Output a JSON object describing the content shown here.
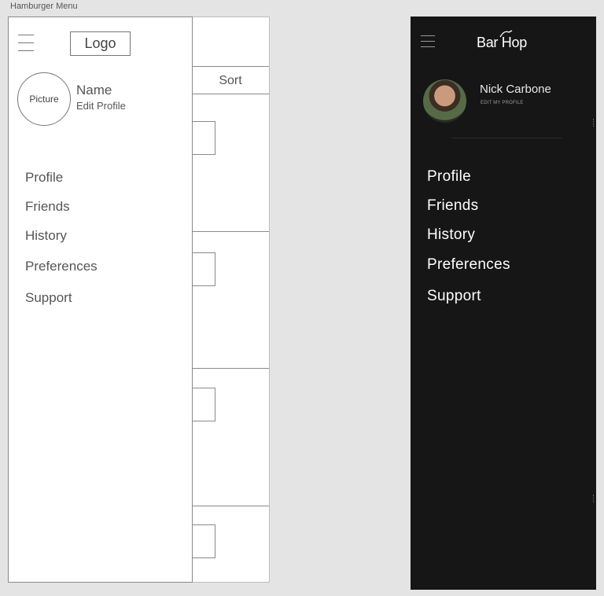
{
  "frame_title": "Hamburger Menu",
  "wireframe": {
    "logo_label": "Logo",
    "picture_label": "Picture",
    "name_label": "Name",
    "edit_profile_label": "Edit Profile",
    "sort_label": "Sort",
    "menu": [
      "Profile",
      "Friends",
      "History",
      "Preferences",
      "Support"
    ]
  },
  "dark": {
    "brand": "Bar Hop",
    "user_name": "Nick Carbone",
    "edit_profile_label": "EDIT MY PROFILE",
    "menu": [
      "Profile",
      "Friends",
      "History",
      "Preferences",
      "Support"
    ],
    "colors": {
      "background": "#161616",
      "text": "#ffffff"
    }
  }
}
